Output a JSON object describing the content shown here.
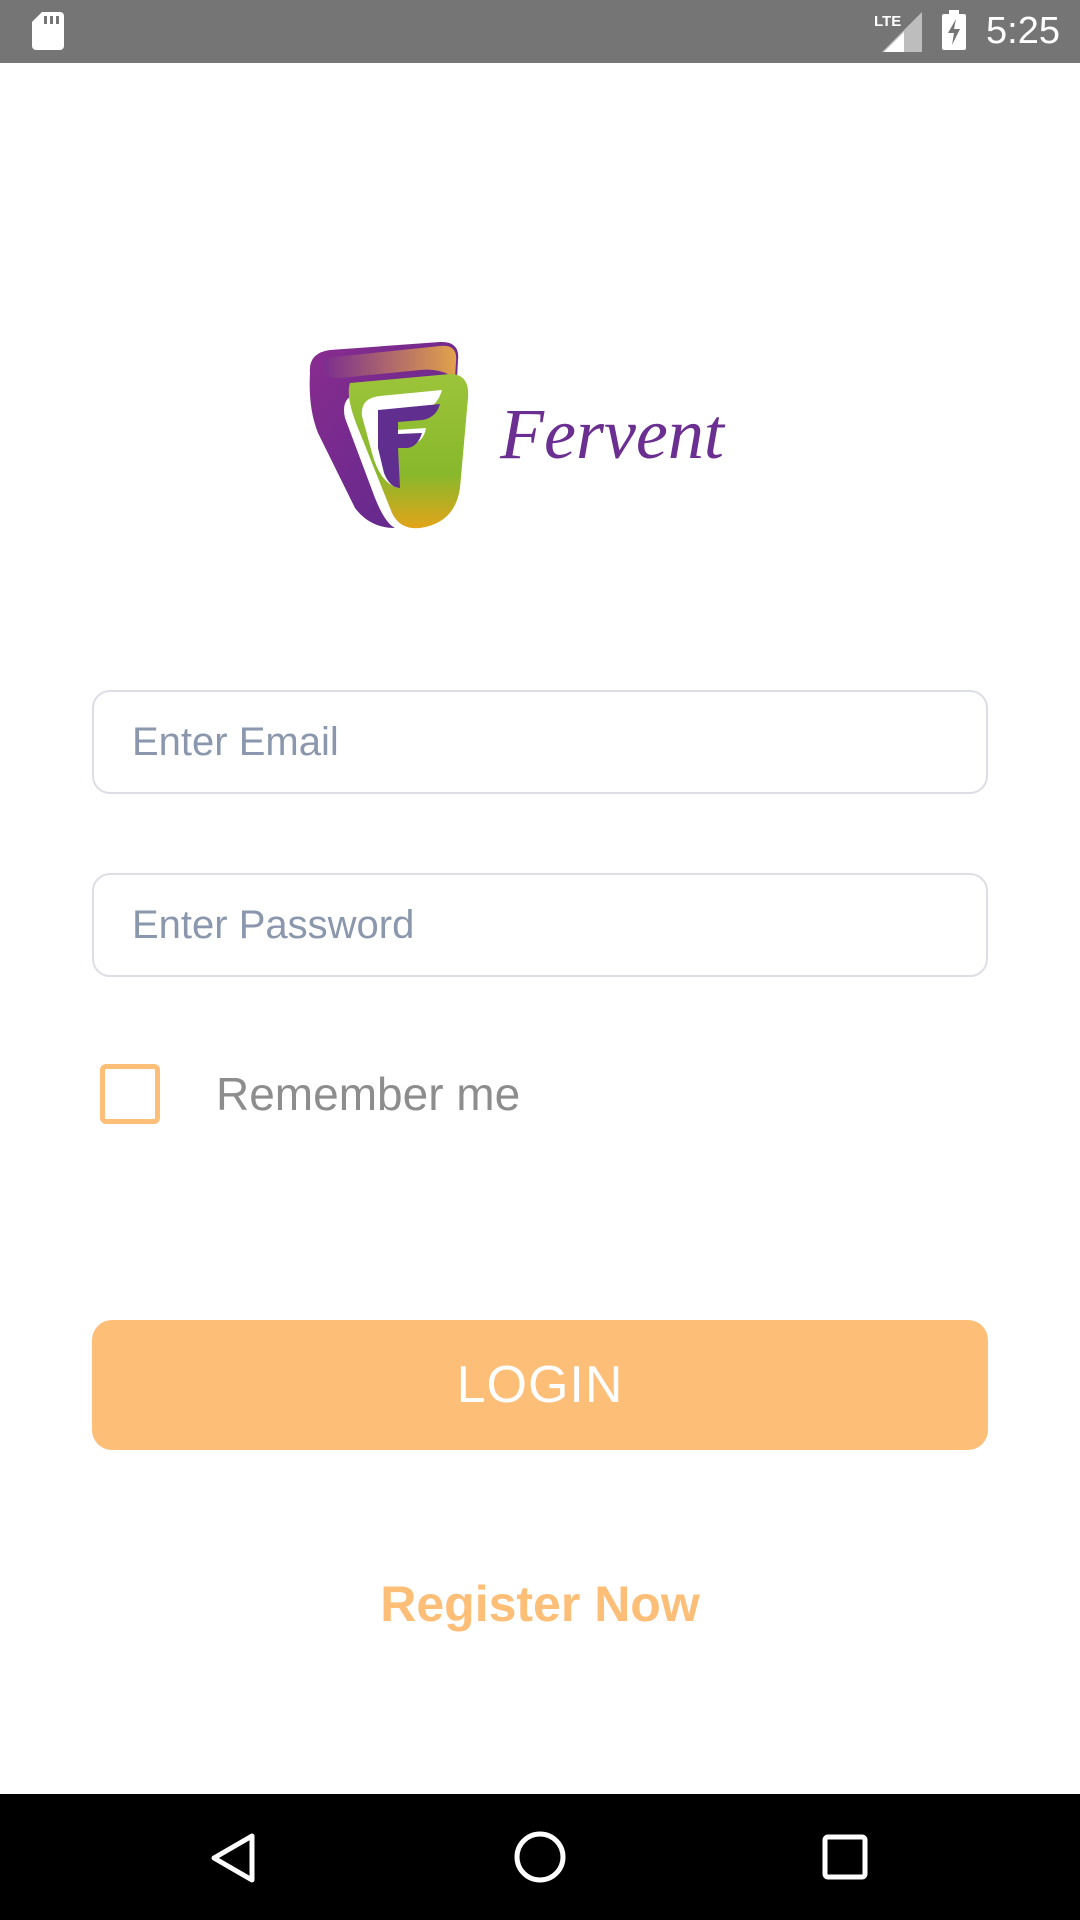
{
  "status_bar": {
    "time": "5:25",
    "network_label": "LTE",
    "icons": [
      "sd-card-icon",
      "lte-signal-icon",
      "battery-charging-icon"
    ]
  },
  "logo": {
    "brand_name": "Fervent",
    "colors": {
      "purple": "#6b2f91",
      "green": "#8dbe2e",
      "gold": "#e6a91a",
      "text": "#6b2f91"
    }
  },
  "form": {
    "email": {
      "placeholder": "Enter Email",
      "value": ""
    },
    "password": {
      "placeholder": "Enter Password",
      "value": ""
    },
    "remember": {
      "label": "Remember me",
      "checked": false
    }
  },
  "actions": {
    "login_label": "LOGIN",
    "register_label": "Register Now"
  },
  "theme": {
    "accent": "#fdbe78",
    "field_border": "#dcdde5",
    "placeholder": "#8b97ad",
    "status_bar": "#757575",
    "nav_bar": "#000000"
  },
  "nav_bar": {
    "icons": [
      "back-icon",
      "home-icon",
      "recent-apps-icon"
    ]
  }
}
